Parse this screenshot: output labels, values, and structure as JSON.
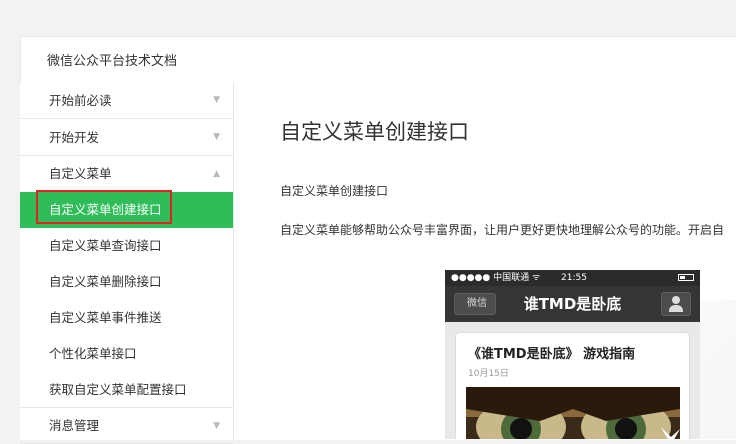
{
  "site": {
    "title": "微信公众平台技术文档"
  },
  "sidebar": {
    "items": [
      {
        "label": "开始前必读",
        "arrow": "▼"
      },
      {
        "label": "开始开发",
        "arrow": "▼"
      },
      {
        "label": "自定义菜单",
        "arrow": "▲"
      }
    ],
    "sub_items": [
      {
        "label": "自定义菜单创建接口"
      },
      {
        "label": "自定义菜单查询接口"
      },
      {
        "label": "自定义菜单删除接口"
      },
      {
        "label": "自定义菜单事件推送"
      },
      {
        "label": "个性化菜单接口"
      },
      {
        "label": "获取自定义菜单配置接口"
      }
    ],
    "after": {
      "label": "消息管理",
      "arrow": "▼"
    }
  },
  "content": {
    "title": "自定义菜单创建接口",
    "para1": "自定义菜单创建接口",
    "para2": "自定义菜单能够帮助公众号丰富界面，让用户更好更快地理解公众号的功能。开启自"
  },
  "phone": {
    "carrier": "●●●●● 中国联通 ᯤ",
    "time": "21:55",
    "back_label": "微信",
    "title": "谁TMD是卧底",
    "card_title": "《谁TMD是卧底》 游戏指南",
    "card_date": "10月15日"
  },
  "colors": {
    "accent": "#2ebd59",
    "highlight": "#e32222"
  }
}
